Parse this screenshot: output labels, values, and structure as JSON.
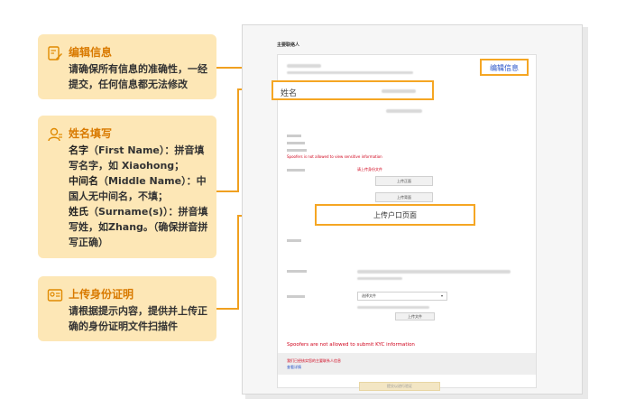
{
  "cards": [
    {
      "icon": "edit-document-icon",
      "title": "编辑信息",
      "body": "请确保所有信息的准确性，一经提交，任何信息都无法修改"
    },
    {
      "icon": "person-icon",
      "title": "姓名填写",
      "lines": [
        {
          "bold": "名字",
          "rest": "（First Name）：拼音填写名字，如 Xiaohong；"
        },
        {
          "bold": "中间名",
          "rest": "（Middle Name）：中国人无中间名，不填；"
        },
        {
          "bold": "姓氏",
          "rest": "（Surname(s)）：拼音填写姓，如Zhang。（确保拼音拼写正确）"
        }
      ]
    },
    {
      "icon": "id-card-icon",
      "title": "上传身份证明",
      "body": "请根据提示内容，提供并上传正确的身份证明文件扫描件"
    }
  ],
  "form": {
    "heading": "主要联络人",
    "edit_button": "编辑信息",
    "name_label": "姓名",
    "warning_top": "Spoofers is not allowed to view sensitive information",
    "upload_note": "请上传身份文件",
    "upload_front": "上传正面",
    "upload_back": "上传背面",
    "upload_household": "上传户口页面",
    "select_placeholder": "选择文件",
    "upload_file": "上传文件",
    "warning_kyc": "Spoofers are not allowed to submit KYC information",
    "terms_text": "我们已经核实您的主要联系人信息",
    "terms_link": "查看详情",
    "submit": "提交以进行验证"
  },
  "colors": {
    "accent": "#f5a623",
    "card_bg": "#fde7b6",
    "title_orange": "#d97a00",
    "link_blue": "#2a55c9",
    "warning_red": "#d0021b"
  }
}
